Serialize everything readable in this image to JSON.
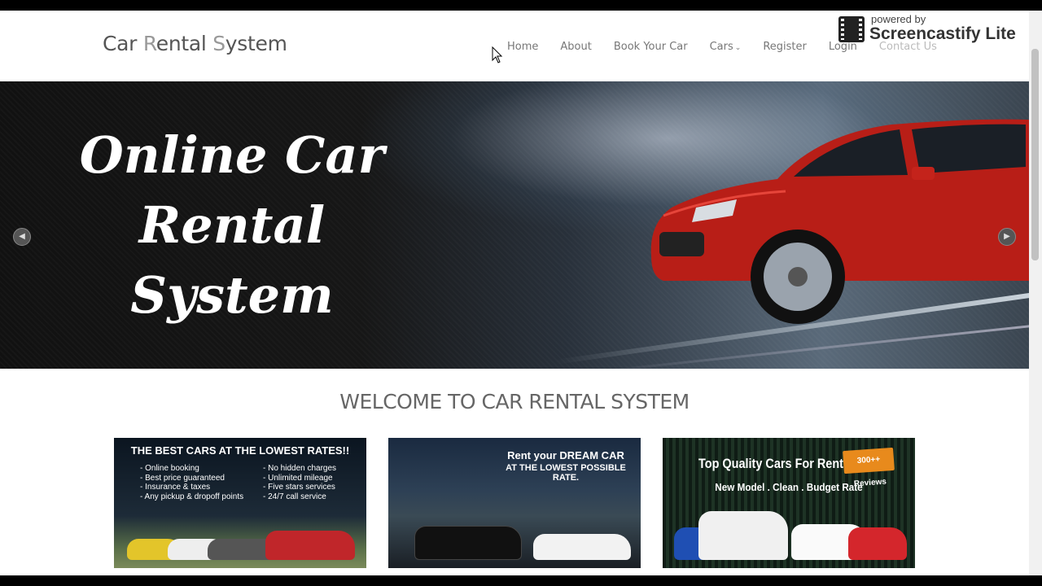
{
  "brand": {
    "part1": "Car ",
    "part2": "R",
    "part3": "ental ",
    "part4": "S",
    "part5": "ystem"
  },
  "nav": {
    "home": "Home",
    "about": "About",
    "book": "Book Your Car",
    "cars": "Cars",
    "register": "Register",
    "login": "Login",
    "contact": "Contact Us"
  },
  "hero": {
    "line1": "Online Car",
    "line2": "Rental",
    "line3": "System",
    "prev_icon": "chevron-left-icon",
    "next_icon": "chevron-right-icon"
  },
  "welcome": "WELCOME TO CAR RENTAL SYSTEM",
  "cards": [
    {
      "title": "THE BEST CARS AT THE LOWEST RATES!!",
      "left": [
        "- Online booking",
        "- Best price guaranteed",
        "- Insurance & taxes",
        "- Any pickup & dropoff points"
      ],
      "right": [
        "- No hidden charges",
        "- Unlimited mileage",
        "- Five stars services",
        "- 24/7 call service"
      ]
    },
    {
      "line1": "Rent your DREAM CAR",
      "line2": "AT THE LOWEST POSSIBLE RATE."
    },
    {
      "title": "Top Quality Cars For Rent",
      "badge": "300++ Reviews",
      "subtitle": "New Model . Clean . Budget Rate"
    }
  ],
  "watermark": {
    "powered": "powered by",
    "name": "Screencastify Lite"
  },
  "colors": {
    "hero_car": "#c8231b",
    "badge": "#e88a1c"
  }
}
